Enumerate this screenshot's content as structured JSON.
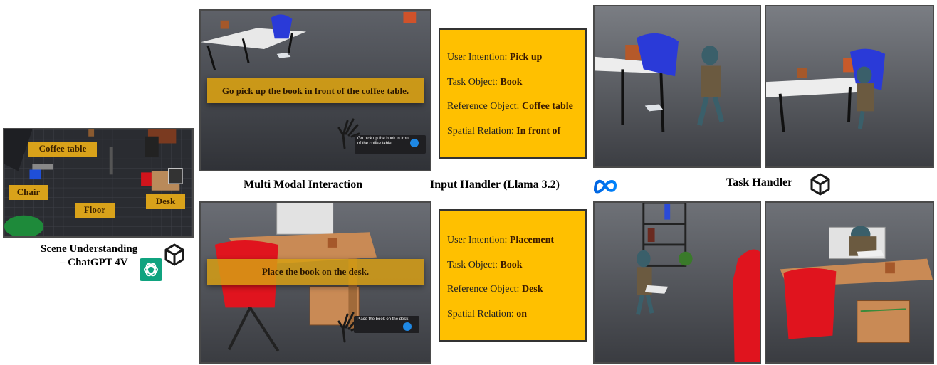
{
  "scene": {
    "labels": [
      "Coffee table",
      "Chair",
      "Floor",
      "Desk"
    ],
    "caption_line1": "Scene Understanding",
    "caption_line2": "– ChatGPT 4V"
  },
  "interaction": {
    "caption": "Multi Modal Interaction",
    "command1": "Go pick up the book in front of the coffee table.",
    "voice1": "Go pick up the book in front of the coffee table",
    "command2": "Place the book on the desk.",
    "voice2": "Place the book on the desk"
  },
  "input_handler": {
    "caption": "Input Handler (Llama 3.2)",
    "box1": [
      {
        "key": "User Intention:",
        "value": "Pick up"
      },
      {
        "key": "Task Object:",
        "value": "Book"
      },
      {
        "key": "Reference Object:",
        "value": "Coffee table"
      },
      {
        "key": "Spatial Relation:",
        "value": "In front of"
      }
    ],
    "box2": [
      {
        "key": "User Intention:",
        "value": "Placement"
      },
      {
        "key": "Task Object:",
        "value": "Book"
      },
      {
        "key": "Reference Object:",
        "value": "Desk"
      },
      {
        "key": "Spatial Relation:",
        "value": "on"
      }
    ]
  },
  "task_handler": {
    "caption": "Task Handler"
  },
  "icons": [
    "unity-icon",
    "openai-icon",
    "meta-icon"
  ],
  "colors": {
    "info_box": "#ffc000",
    "label_gold": "#d9a21a",
    "chair_red": "#e0141e",
    "chair_blue": "#2a3ad8",
    "desk_wood": "#c98a55",
    "floor_gray": "#5a5d63"
  }
}
